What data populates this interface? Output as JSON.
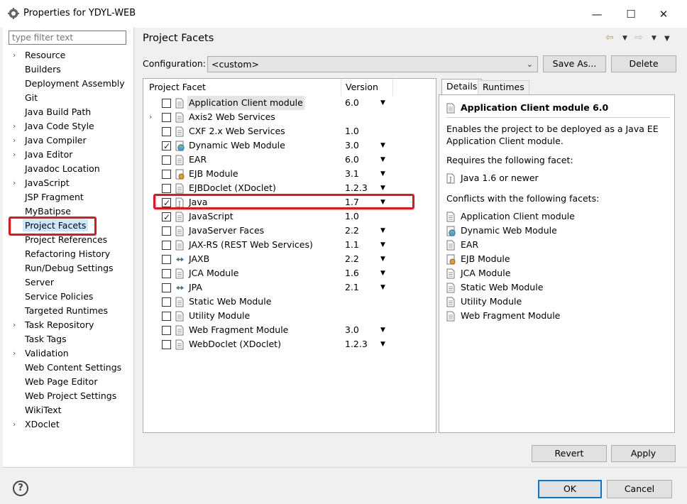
{
  "window": {
    "title": "Properties for YDYL-WEB",
    "minimize_icon": "minimize-icon",
    "maximize_icon": "maximize-icon",
    "close_icon": "close-icon"
  },
  "filter": {
    "placeholder": "type filter text"
  },
  "nav": {
    "items": [
      {
        "label": "Resource",
        "expandable": true
      },
      {
        "label": "Builders",
        "expandable": false
      },
      {
        "label": "Deployment Assembly",
        "expandable": false
      },
      {
        "label": "Git",
        "expandable": false
      },
      {
        "label": "Java Build Path",
        "expandable": false
      },
      {
        "label": "Java Code Style",
        "expandable": true
      },
      {
        "label": "Java Compiler",
        "expandable": true
      },
      {
        "label": "Java Editor",
        "expandable": true
      },
      {
        "label": "Javadoc Location",
        "expandable": false
      },
      {
        "label": "JavaScript",
        "expandable": true
      },
      {
        "label": "JSP Fragment",
        "expandable": false
      },
      {
        "label": "MyBatipse",
        "expandable": false
      },
      {
        "label": "Project Facets",
        "expandable": false,
        "selected": true
      },
      {
        "label": "Project References",
        "expandable": false
      },
      {
        "label": "Refactoring History",
        "expandable": false
      },
      {
        "label": "Run/Debug Settings",
        "expandable": false
      },
      {
        "label": "Server",
        "expandable": false
      },
      {
        "label": "Service Policies",
        "expandable": false
      },
      {
        "label": "Targeted Runtimes",
        "expandable": false
      },
      {
        "label": "Task Repository",
        "expandable": true
      },
      {
        "label": "Task Tags",
        "expandable": false
      },
      {
        "label": "Validation",
        "expandable": true
      },
      {
        "label": "Web Content Settings",
        "expandable": false
      },
      {
        "label": "Web Page Editor",
        "expandable": false
      },
      {
        "label": "Web Project Settings",
        "expandable": false
      },
      {
        "label": "WikiText",
        "expandable": false
      },
      {
        "label": "XDoclet",
        "expandable": true
      }
    ]
  },
  "page": {
    "title": "Project Facets",
    "config_label": "Configuration:",
    "config_value": "<custom>",
    "save_as": "Save As...",
    "delete": "Delete"
  },
  "facets": {
    "col_facet": "Project Facet",
    "col_version": "Version",
    "rows": [
      {
        "name": "Application Client module",
        "version": "6.0",
        "checked": false,
        "dropdown": true,
        "icon": "page-icon",
        "highlighted": true
      },
      {
        "name": "Axis2 Web Services",
        "version": "",
        "checked": false,
        "dropdown": false,
        "icon": "page-icon",
        "expandable": true
      },
      {
        "name": "CXF 2.x Web Services",
        "version": "1.0",
        "checked": false,
        "dropdown": false,
        "icon": "page-icon"
      },
      {
        "name": "Dynamic Web Module",
        "version": "3.0",
        "checked": true,
        "dropdown": true,
        "icon": "globe-icon"
      },
      {
        "name": "EAR",
        "version": "6.0",
        "checked": false,
        "dropdown": true,
        "icon": "page-icon"
      },
      {
        "name": "EJB Module",
        "version": "3.1",
        "checked": false,
        "dropdown": true,
        "icon": "bean-icon"
      },
      {
        "name": "EJBDoclet (XDoclet)",
        "version": "1.2.3",
        "checked": false,
        "dropdown": true,
        "icon": "page-icon"
      },
      {
        "name": "Java",
        "version": "1.7",
        "checked": true,
        "dropdown": true,
        "icon": "java-file-icon"
      },
      {
        "name": "JavaScript",
        "version": "1.0",
        "checked": true,
        "dropdown": false,
        "icon": "page-icon"
      },
      {
        "name": "JavaServer Faces",
        "version": "2.2",
        "checked": false,
        "dropdown": true,
        "icon": "page-icon"
      },
      {
        "name": "JAX-RS (REST Web Services)",
        "version": "1.1",
        "checked": false,
        "dropdown": true,
        "icon": "page-icon"
      },
      {
        "name": "JAXB",
        "version": "2.2",
        "checked": false,
        "dropdown": true,
        "icon": "arrows-icon"
      },
      {
        "name": "JCA Module",
        "version": "1.6",
        "checked": false,
        "dropdown": true,
        "icon": "page-icon"
      },
      {
        "name": "JPA",
        "version": "2.1",
        "checked": false,
        "dropdown": true,
        "icon": "arrows-icon"
      },
      {
        "name": "Static Web Module",
        "version": "",
        "checked": false,
        "dropdown": false,
        "icon": "page-icon"
      },
      {
        "name": "Utility Module",
        "version": "",
        "checked": false,
        "dropdown": false,
        "icon": "page-icon"
      },
      {
        "name": "Web Fragment Module",
        "version": "3.0",
        "checked": false,
        "dropdown": true,
        "icon": "page-icon"
      },
      {
        "name": "WebDoclet (XDoclet)",
        "version": "1.2.3",
        "checked": false,
        "dropdown": true,
        "icon": "page-icon"
      }
    ]
  },
  "details": {
    "tab_details": "Details",
    "tab_runtimes": "Runtimes",
    "title": "Application Client module 6.0",
    "description": "Enables the project to be deployed as a Java EE Application Client module.",
    "requires_label": "Requires the following facet:",
    "requires": [
      {
        "label": "Java 1.6 or newer",
        "icon": "java-file-icon"
      }
    ],
    "conflicts_label": "Conflicts with the following facets:",
    "conflicts": [
      {
        "label": "Application Client module",
        "icon": "page-icon"
      },
      {
        "label": "Dynamic Web Module",
        "icon": "globe-icon"
      },
      {
        "label": "EAR",
        "icon": "page-icon"
      },
      {
        "label": "EJB Module",
        "icon": "bean-icon"
      },
      {
        "label": "JCA Module",
        "icon": "page-icon"
      },
      {
        "label": "Static Web Module",
        "icon": "page-icon"
      },
      {
        "label": "Utility Module",
        "icon": "page-icon"
      },
      {
        "label": "Web Fragment Module",
        "icon": "page-icon"
      }
    ]
  },
  "buttons": {
    "revert": "Revert",
    "apply": "Apply",
    "ok": "OK",
    "cancel": "Cancel"
  },
  "colors": {
    "highlight_box": "#e8141c",
    "selection": "#cce8ff",
    "default_button_border": "#0078d7"
  }
}
